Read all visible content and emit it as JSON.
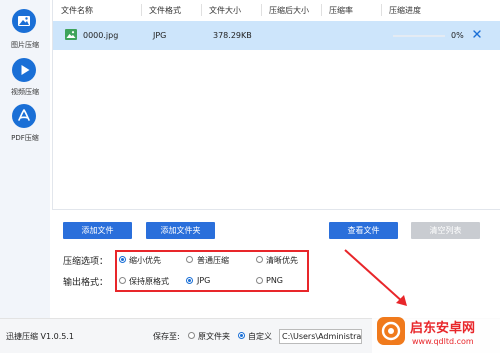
{
  "sidebar": {
    "items": [
      {
        "label": "图片压缩",
        "icon": "image-icon"
      },
      {
        "label": "视频压缩",
        "icon": "play-icon"
      },
      {
        "label": "PDF压缩",
        "icon": "pdf-icon"
      }
    ]
  },
  "table": {
    "columns": [
      "文件名称",
      "文件格式",
      "文件大小",
      "压缩后大小",
      "压缩率",
      "压缩进度"
    ],
    "rows": [
      {
        "name": "0000.jpg",
        "format": "JPG",
        "size": "378.29KB",
        "compressed_size": "",
        "ratio": "",
        "progress_text": "0%",
        "progress": 0
      }
    ]
  },
  "buttons": {
    "add_file": "添加文件",
    "add_folder": "添加文件夹",
    "view_file": "查看文件",
    "clear_list": "清空列表"
  },
  "options": {
    "compress_label": "压缩选项：",
    "compress_choices": [
      "缩小优先",
      "普通压缩",
      "清晰优先"
    ],
    "compress_selected": "缩小优先",
    "format_label": "输出格式：",
    "format_choices": [
      "保持原格式",
      "JPG",
      "PNG"
    ],
    "format_selected": "JPG"
  },
  "footer": {
    "version": "迅捷压缩 V1.0.5.1",
    "save_to_label": "保存至:",
    "save_choices": [
      "原文件夹",
      "自定义"
    ],
    "save_selected": "自定义",
    "path_value": "C:\\Users\\Administrat"
  },
  "watermark": {
    "text": "启东安卓网",
    "url": "www.qdltd.com"
  },
  "colors": {
    "accent": "#1a6fd6",
    "button": "#2a6fdb",
    "selected_row": "#cde5fb",
    "highlight_box": "#e8262a",
    "disabled_button": "#c9ccd1"
  }
}
